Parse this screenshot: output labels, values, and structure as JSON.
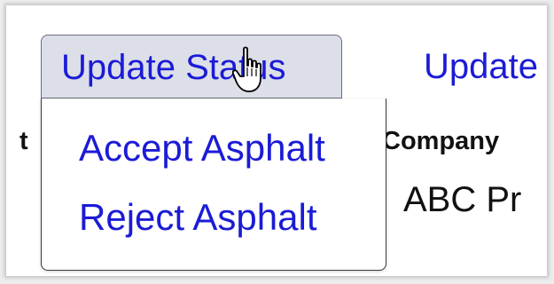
{
  "toolbar": {
    "update_status_label": "Update Status",
    "update_label": "Update"
  },
  "dropdown": {
    "items": [
      {
        "label": "Accept Asphalt"
      },
      {
        "label": "Reject Asphalt"
      }
    ]
  },
  "table": {
    "headers": {
      "left_partial": "t",
      "company": "Company"
    },
    "rows": [
      {
        "company": "ABC Pr"
      }
    ]
  },
  "cursor": {
    "icon": "hand-pointer-icon"
  },
  "colors": {
    "link": "#1b1bd6",
    "button_bg": "#dcdfe8"
  }
}
